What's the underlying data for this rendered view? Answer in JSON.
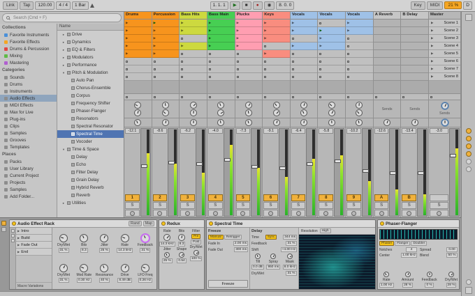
{
  "transport": {
    "link": "Link",
    "tap": "Tap",
    "tempo": "120.00",
    "signature": "4 / 4",
    "quantize": "1 Bar",
    "position": "1. 1. 1",
    "loop": "8. 0. 0",
    "key": "Key",
    "midi": "MIDI",
    "cpu": "21 %",
    "disk": "D"
  },
  "browser": {
    "search_placeholder": "Search (Cmd + F)",
    "list_header": "Name",
    "sections": [
      {
        "title": "Collections",
        "items": [
          {
            "label": "Favorite Instruments",
            "color": "#4a90d9"
          },
          {
            "label": "Favorite Effects",
            "color": "#f5a623"
          },
          {
            "label": "Drums & Percussion",
            "color": "#e04646"
          },
          {
            "label": "Mixing",
            "color": "#5fba46"
          },
          {
            "label": "Mastering",
            "color": "#b05fd0"
          }
        ]
      },
      {
        "title": "Categories",
        "items": [
          {
            "label": "Sounds"
          },
          {
            "label": "Drums"
          },
          {
            "label": "Instruments"
          },
          {
            "label": "Audio Effects",
            "selected": true
          },
          {
            "label": "MIDI Effects"
          },
          {
            "label": "Max for Live"
          },
          {
            "label": "Plug-ins"
          },
          {
            "label": "Clips"
          },
          {
            "label": "Samples"
          },
          {
            "label": "Grooves"
          },
          {
            "label": "Templates"
          }
        ]
      },
      {
        "title": "Places",
        "items": [
          {
            "label": "Packs"
          },
          {
            "label": "User Library"
          },
          {
            "label": "Current Project"
          },
          {
            "label": "Projects"
          },
          {
            "label": "Samples"
          },
          {
            "label": "Add Folder..."
          }
        ]
      }
    ],
    "files": [
      {
        "label": "Drive",
        "kind": "folder",
        "indent": 1
      },
      {
        "label": "Dynamics",
        "kind": "folder",
        "indent": 1
      },
      {
        "label": "EQ & Filters",
        "kind": "folder",
        "indent": 1
      },
      {
        "label": "Modulators",
        "kind": "folder",
        "indent": 1
      },
      {
        "label": "Performance",
        "kind": "folder",
        "indent": 1
      },
      {
        "label": "Pitch & Modulation",
        "kind": "folder-open",
        "indent": 1
      },
      {
        "label": "Auto Pan",
        "kind": "device",
        "indent": 2
      },
      {
        "label": "Chorus-Ensemble",
        "kind": "device",
        "indent": 2
      },
      {
        "label": "Corpus",
        "kind": "device",
        "indent": 2
      },
      {
        "label": "Frequency Shifter",
        "kind": "device",
        "indent": 2
      },
      {
        "label": "Phaser-Flanger",
        "kind": "device",
        "indent": 2
      },
      {
        "label": "Resonators",
        "kind": "device",
        "indent": 2
      },
      {
        "label": "Spectral Resonator",
        "kind": "device",
        "indent": 2
      },
      {
        "label": "Spectral Time",
        "kind": "device",
        "indent": 2,
        "selected": true
      },
      {
        "label": "Vocoder",
        "kind": "device",
        "indent": 2
      },
      {
        "label": "Time & Space",
        "kind": "folder-open",
        "indent": 1
      },
      {
        "label": "Delay",
        "kind": "device",
        "indent": 2
      },
      {
        "label": "Echo",
        "kind": "device",
        "indent": 2
      },
      {
        "label": "Filter Delay",
        "kind": "device",
        "indent": 2
      },
      {
        "label": "Grain Delay",
        "kind": "device",
        "indent": 2
      },
      {
        "label": "Hybrid Reverb",
        "kind": "device",
        "indent": 2
      },
      {
        "label": "Reverb",
        "kind": "device",
        "indent": 2
      },
      {
        "label": "Utilities",
        "kind": "folder",
        "indent": 1
      }
    ]
  },
  "session": {
    "solo_label": "S",
    "sends_label": "Sends",
    "scenes": [
      "Scene 1",
      "Scene 2",
      "Scene 3",
      "Scene 4",
      "Scene 5",
      "Scene 6",
      "Scene 7",
      "Scene 8"
    ],
    "tracks": [
      {
        "name": "Drums",
        "num": "1",
        "color": "#f7941d",
        "clips": [
          "c",
          "c",
          "c",
          "c",
          "c",
          "s",
          "s",
          "s"
        ],
        "db": "-12.1",
        "meter": 0.72,
        "fader": 0.58
      },
      {
        "name": "Percussion",
        "num": "2",
        "color": "#f7941d",
        "clips": [
          "p",
          "c",
          "c",
          "c",
          "c",
          "s",
          "s",
          "s"
        ],
        "db": "-8.6",
        "meter": 0.6,
        "fader": 0.62
      },
      {
        "name": "Bass Hits",
        "num": "3",
        "color": "#cdd93f",
        "clips": [
          "c",
          "c",
          "s",
          "c",
          "s",
          "s",
          "s",
          "s"
        ],
        "db": "-6.2",
        "meter": 0.5,
        "fader": 0.6
      },
      {
        "name": "Bass Main",
        "num": "4",
        "color": "#47cf53",
        "clips": [
          "c",
          "p",
          "c",
          "c",
          "s",
          "s",
          "s",
          "s"
        ],
        "db": "-4.0",
        "meter": 0.82,
        "fader": 0.65
      },
      {
        "name": "Plucks",
        "num": "5",
        "color": "#ff9eb1",
        "clips": [
          "c",
          "c",
          "c",
          "c",
          "s",
          "s",
          "s",
          "s"
        ],
        "db": "-7.3",
        "meter": 0.55,
        "fader": 0.57
      },
      {
        "name": "Keys",
        "num": "6",
        "color": "#f98d7f",
        "clips": [
          "c",
          "c",
          "c",
          "s",
          "c",
          "s",
          "s",
          "s"
        ],
        "db": "-9.1",
        "meter": 0.45,
        "fader": 0.55
      },
      {
        "name": "Vocals",
        "num": "7",
        "color": "#9fc1e7",
        "clips": [
          "c",
          "c",
          "s",
          "c",
          "s",
          "s",
          "s",
          "s"
        ],
        "db": "-6.4",
        "meter": 0.66,
        "fader": 0.6
      },
      {
        "name": "Vocals",
        "num": "8",
        "color": "#9fc1e7",
        "clips": [
          "s",
          "p",
          "c",
          "c",
          "s",
          "s",
          "s",
          "s"
        ],
        "db": "-5.8",
        "meter": 0.7,
        "fader": 0.63
      },
      {
        "name": "Vocals",
        "num": "9",
        "color": "#9fc1e7",
        "clips": [
          "c",
          "c",
          "s",
          "s",
          "s",
          "s",
          "s",
          "s"
        ],
        "db": "-10.2",
        "meter": 0.4,
        "fader": 0.52
      },
      {
        "name": "A Reverb",
        "num": "A",
        "color": "#c6c6c6",
        "clips": [
          "e",
          "e",
          "e",
          "e",
          "e",
          "e",
          "e",
          "e"
        ],
        "db": "-12.6",
        "meter": 0.3,
        "fader": 0.5,
        "isReturn": true
      },
      {
        "name": "B Delay",
        "num": "B",
        "color": "#c6c6c6",
        "clips": [
          "e",
          "e",
          "e",
          "e",
          "e",
          "e",
          "e",
          "e"
        ],
        "db": "-13.4",
        "meter": 0.24,
        "fader": 0.5,
        "isReturn": true
      }
    ],
    "master": {
      "name": "Master",
      "db": "-3.0",
      "meter": 0.78,
      "fader": 0.7
    }
  },
  "devices": {
    "rack": {
      "title": "Audio Effect Rack",
      "rand": "Rand",
      "map": "Map",
      "chains": [
        "Intro",
        "Build",
        "Fade Out",
        "End"
      ],
      "macro_variations": "Macro Variations",
      "macros": [
        {
          "label": "Dry/Wet",
          "value": "31 %"
        },
        {
          "label": "Bits",
          "value": "8.3"
        },
        {
          "label": "Jitter",
          "value": "25 %"
        },
        {
          "label": "Rate",
          "value": "14.3 kHz"
        },
        {
          "label": "Feedback",
          "value": "31 %",
          "accent": "#c76bf0"
        },
        {
          "label": "Dry/Wet",
          "value": "31 %"
        },
        {
          "label": "Mod Rate",
          "value": "0.30 Hz"
        },
        {
          "label": "Resonance",
          "value": "40 %"
        },
        {
          "label": "Drive",
          "value": "8.49 dB"
        },
        {
          "label": "LFO Freq",
          "value": "0.26 Hz"
        }
      ]
    },
    "redux": {
      "title": "Redux",
      "rate_label": "Rate",
      "rate": "14.3 kHz",
      "jitter_label": "Jitter",
      "jitter": "25 %",
      "bits_label": "Bits",
      "bits": "8.3",
      "shape_label": "Shape",
      "shape": "0.54",
      "filter_label": "Filter",
      "pre": "Pre",
      "post": "Post",
      "drywet_label": "Dry/Wet",
      "drywet": "100 %"
    },
    "spectral": {
      "title": "Spectral Time",
      "freeze_header": "Freeze",
      "manual": "Manual",
      "retrigger": "Retrigger",
      "fadein_label": "Fade In",
      "fadein": "2.00 ms",
      "fadeout_label": "Fade Out",
      "fadeout": "300 ms",
      "freeze_button": "Freeze",
      "delay_header": "Delay",
      "sync": "Sync",
      "time_label": "Time",
      "time": "344 ms",
      "feedback_label": "Feedback",
      "feedback": "31 %",
      "shift_label": "Shift",
      "shift": "+4.00 Hz",
      "tilt_label": "Tilt",
      "tilt": "0.0 dB",
      "spray_label": "Spray",
      "spray": "950 ms",
      "mask_label": "Mask",
      "mask": "8.0 kHz",
      "drywet_label": "Dry/Wet",
      "drywet": "31 %",
      "resolution_label": "Resolution",
      "resolution": "High"
    },
    "phaser": {
      "title": "Phaser-Flanger",
      "modes": [
        "Phaser",
        "Flanger",
        "Doubler"
      ],
      "selected_mode": "Phaser",
      "notches_label": "Notches",
      "notches": "4",
      "center_label": "Center",
      "center": "1.00 kHz",
      "spread_label": "Spread",
      "spread": "0.00",
      "blend_label": "Blend",
      "blend": "50 %",
      "rate_label": "Rate",
      "rate": "1.00 Hz",
      "amount_label": "Amount",
      "amount": "28 %",
      "feedback_label": "Feedback",
      "feedback": "0 %",
      "drywet_label": "Dry/Wet",
      "drywet": "28 %"
    }
  }
}
